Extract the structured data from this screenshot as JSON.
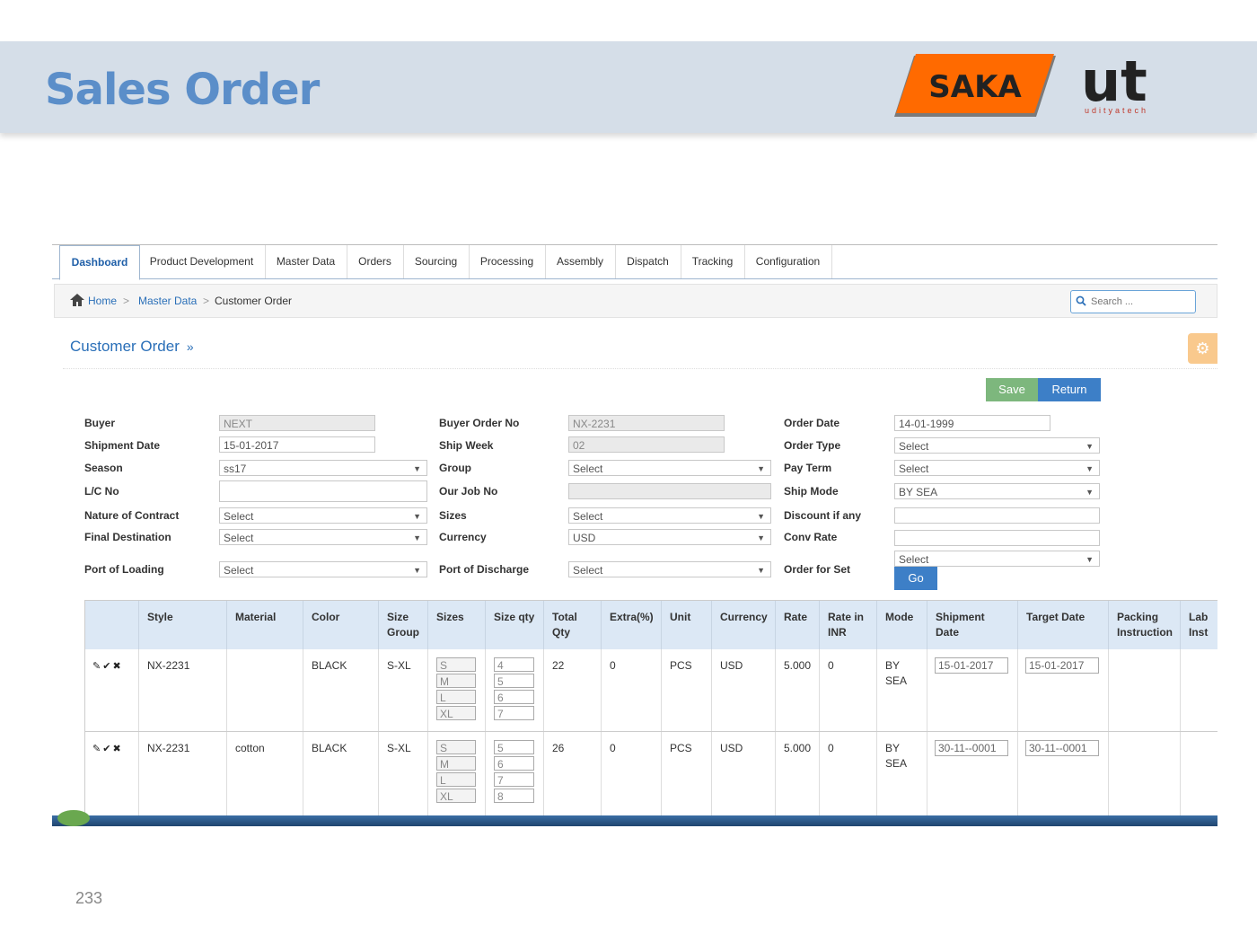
{
  "slide": {
    "title": "Sales Order",
    "page_number": "233",
    "logo_saka": "SAKA",
    "logo_ut": "ut",
    "logo_ut_sub": "udityatech"
  },
  "nav": {
    "tabs": [
      "Dashboard",
      "Product Development",
      "Master Data",
      "Orders",
      "Sourcing",
      "Processing",
      "Assembly",
      "Dispatch",
      "Tracking",
      "Configuration"
    ],
    "active": "Dashboard"
  },
  "breadcrumb": {
    "home": "Home",
    "sep": ">",
    "level1": "Master Data",
    "current": "Customer Order"
  },
  "search": {
    "placeholder": "Search ..."
  },
  "page": {
    "heading": "Customer Order",
    "heading_arrow": "»"
  },
  "toolbar": {
    "save_label": "Save",
    "return_label": "Return",
    "go_label": "Go"
  },
  "form": {
    "buyer": {
      "label": "Buyer",
      "value": "NEXT"
    },
    "buyer_order_no": {
      "label": "Buyer Order No",
      "value": "NX-2231"
    },
    "order_date": {
      "label": "Order Date",
      "value": "14-01-1999"
    },
    "shipment_date": {
      "label": "Shipment Date",
      "value": "15-01-2017"
    },
    "ship_week": {
      "label": "Ship Week",
      "value": "02"
    },
    "order_type": {
      "label": "Order Type",
      "value": "Select"
    },
    "season": {
      "label": "Season",
      "value": "ss17"
    },
    "group": {
      "label": "Group",
      "value": "Select"
    },
    "pay_term": {
      "label": "Pay Term",
      "value": "Select"
    },
    "lc_no": {
      "label": "L/C No",
      "value": ""
    },
    "our_job_no": {
      "label": "Our Job No",
      "value": ""
    },
    "ship_mode": {
      "label": "Ship Mode",
      "value": "BY SEA"
    },
    "nature_of_contract": {
      "label": "Nature of Contract",
      "value": "Select"
    },
    "sizes": {
      "label": "Sizes",
      "value": "Select"
    },
    "discount": {
      "label": "Discount if any",
      "value": ""
    },
    "final_destination": {
      "label": "Final Destination",
      "value": "Select"
    },
    "currency": {
      "label": "Currency",
      "value": "USD"
    },
    "conv_rate": {
      "label": "Conv Rate",
      "value": ""
    },
    "port_of_loading": {
      "label": "Port of Loading",
      "value": "Select"
    },
    "port_of_discharge": {
      "label": "Port of Discharge",
      "value": "Select"
    },
    "order_for_set": {
      "label": "Order for Set",
      "value": "Select"
    }
  },
  "table": {
    "headers": {
      "style": "Style",
      "material": "Material",
      "color": "Color",
      "size_group_1": "Size",
      "size_group_2": "Group",
      "sizes": "Sizes",
      "size_qty": "Size qty",
      "total_qty_1": "Total",
      "total_qty_2": "Qty",
      "extra": "Extra(%)",
      "unit": "Unit",
      "currency": "Currency",
      "rate": "Rate",
      "rate_inr_1": "Rate in",
      "rate_inr_2": "INR",
      "mode": "Mode",
      "shipment_date_1": "Shipment",
      "shipment_date_2": "Date",
      "target_date": "Target Date",
      "packing_1": "Packing",
      "packing_2": "Instruction",
      "label_1": "Lab",
      "label_2": "Inst"
    },
    "rows": [
      {
        "icons": "✎✔✖",
        "style": "NX-2231",
        "material": "",
        "color": "BLACK",
        "size_group": "S-XL",
        "sizes": [
          "S",
          "M",
          "L",
          "XL"
        ],
        "size_qty": [
          "4",
          "5",
          "6",
          "7"
        ],
        "total_qty": "22",
        "extra": "0",
        "unit": "PCS",
        "currency": "USD",
        "rate": "5.000",
        "rate_inr": "0",
        "mode_1": "BY",
        "mode_2": "SEA",
        "shipment_date": "15-01-2017",
        "target_date": "15-01-2017"
      },
      {
        "icons": "✎✔✖",
        "style": "NX-2231",
        "material": "cotton",
        "color": "BLACK",
        "size_group": "S-XL",
        "sizes": [
          "S",
          "M",
          "L",
          "XL"
        ],
        "size_qty": [
          "5",
          "6",
          "7",
          "8"
        ],
        "total_qty": "26",
        "extra": "0",
        "unit": "PCS",
        "currency": "USD",
        "rate": "5.000",
        "rate_inr": "0",
        "mode_1": "BY",
        "mode_2": "SEA",
        "shipment_date": "30-11--0001",
        "target_date": "30-11--0001"
      }
    ]
  },
  "colors": {
    "accent": "#3d7fc7",
    "save": "#7db77d",
    "title": "#5b8ec9",
    "saka": "#ff6a00"
  }
}
